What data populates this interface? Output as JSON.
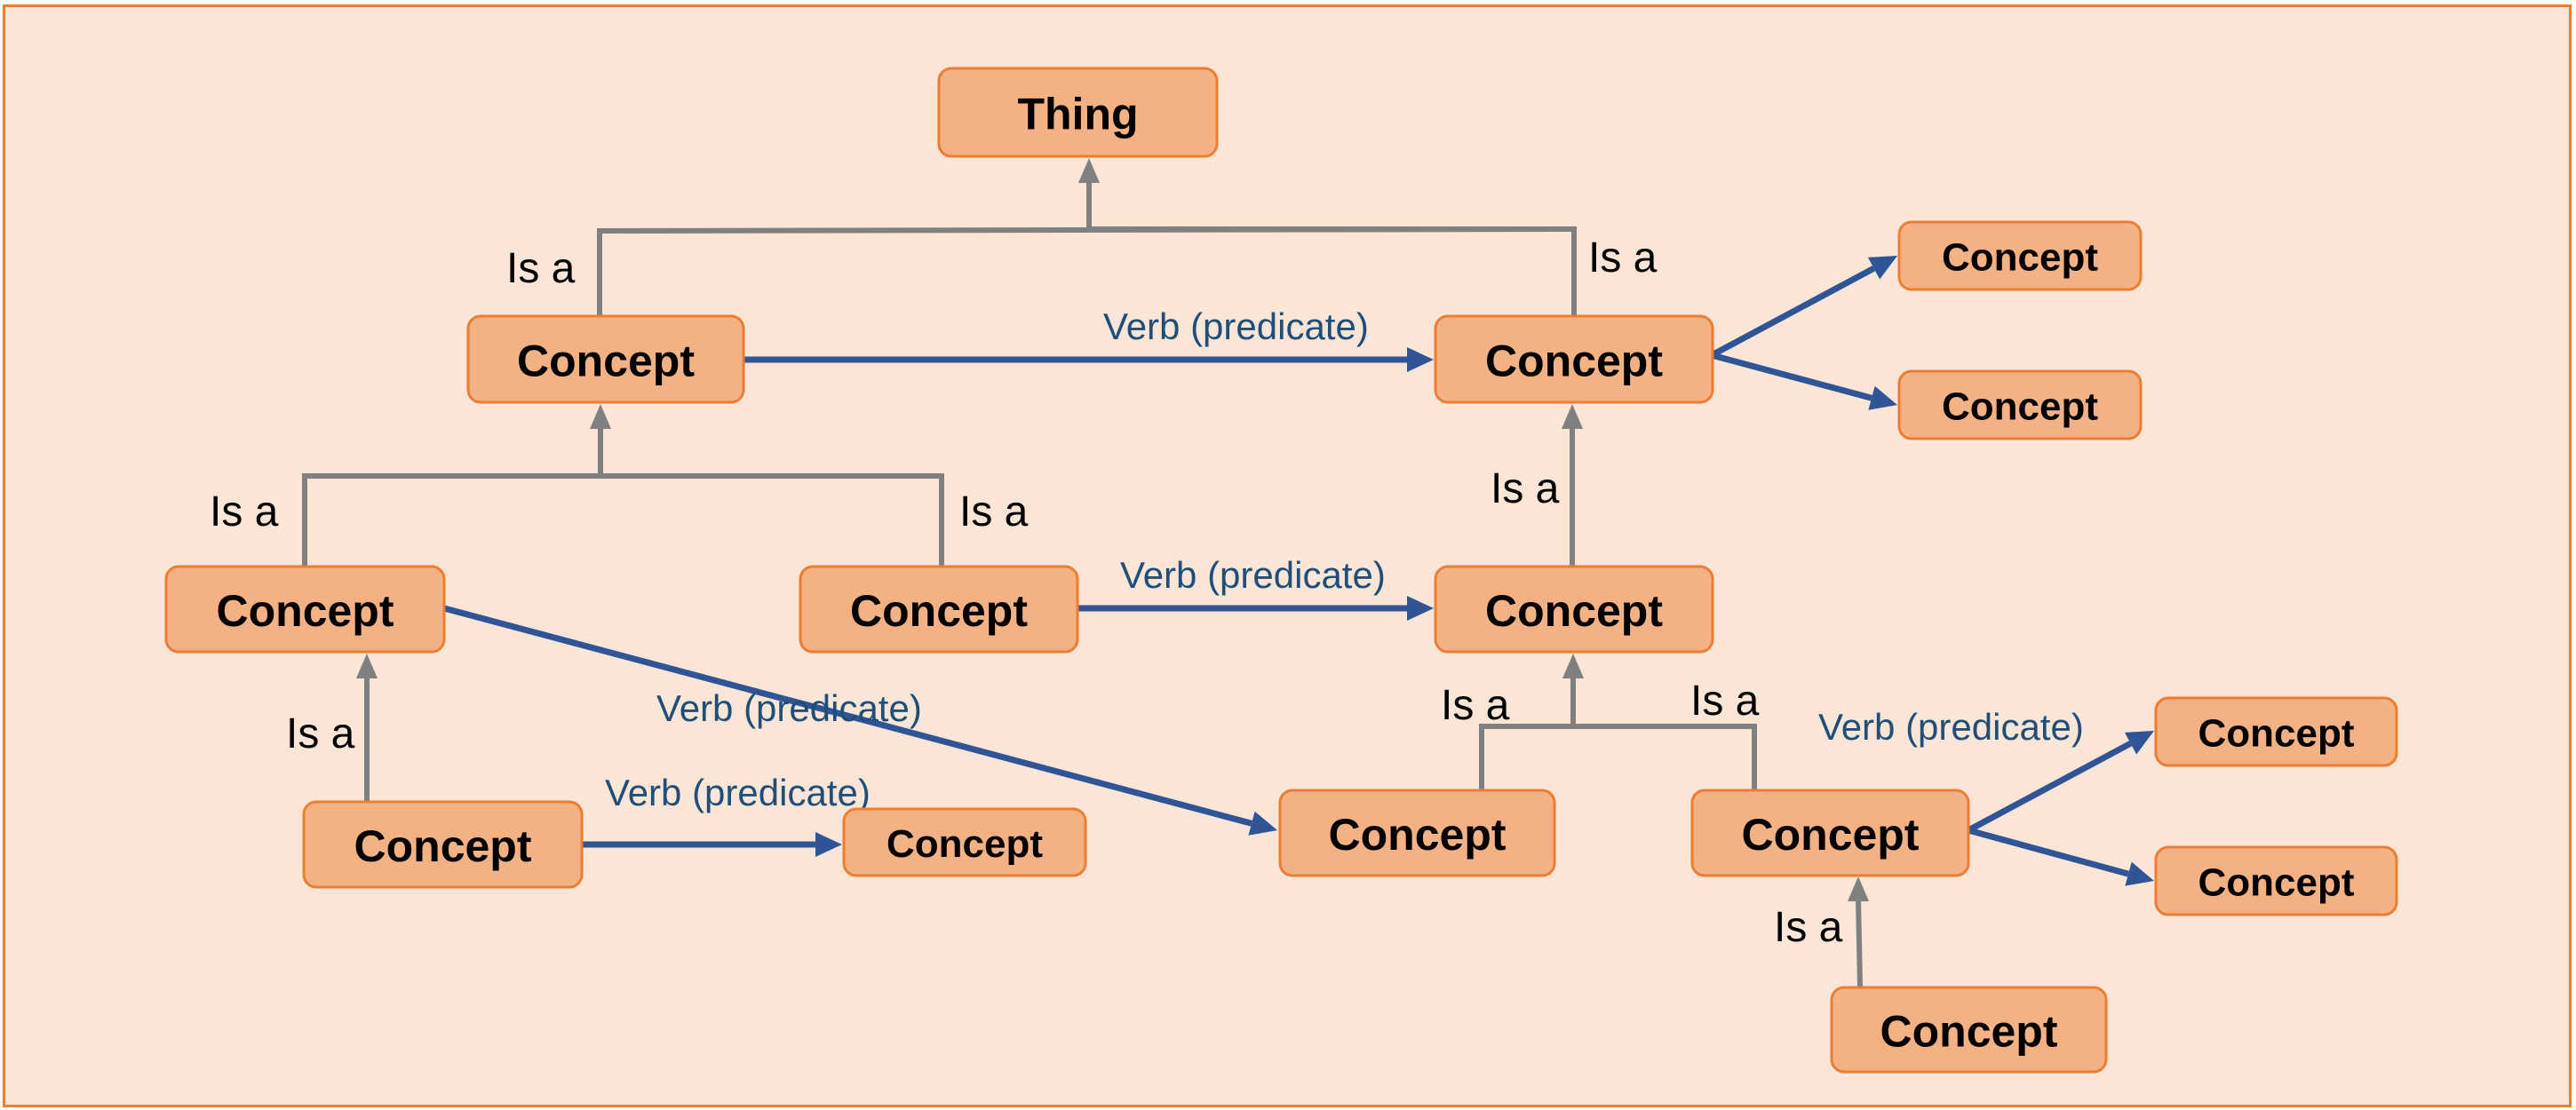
{
  "diagram": {
    "title": "",
    "colors": {
      "background": "#FBE5D6",
      "frame_border": "#ED7D31",
      "node_fill": "#F4B183",
      "node_border": "#ED7D31",
      "isa_edge": "#808080",
      "verb_edge": "#2F5597",
      "verb_label": "#1F4E79",
      "isa_label": "#000000"
    },
    "nodes": [
      {
        "id": "thing",
        "label": "Thing"
      },
      {
        "id": "c1",
        "label": "Concept"
      },
      {
        "id": "c2",
        "label": "Concept"
      },
      {
        "id": "c3",
        "label": "Concept"
      },
      {
        "id": "c4",
        "label": "Concept"
      },
      {
        "id": "c5",
        "label": "Concept"
      },
      {
        "id": "c6",
        "label": "Concept"
      },
      {
        "id": "c7",
        "label": "Concept"
      },
      {
        "id": "c8",
        "label": "Concept"
      },
      {
        "id": "c9",
        "label": "Concept"
      },
      {
        "id": "c10",
        "label": "Concept"
      },
      {
        "id": "c11",
        "label": "Concept"
      },
      {
        "id": "c12",
        "label": "Concept"
      },
      {
        "id": "c13",
        "label": "Concept"
      },
      {
        "id": "c14",
        "label": "Concept"
      }
    ],
    "isa_edges": [
      {
        "from": "c1",
        "to": "thing",
        "label": "Is a"
      },
      {
        "from": "c2",
        "to": "thing",
        "label": "Is a"
      },
      {
        "from": "c5",
        "to": "c1",
        "label": "Is a"
      },
      {
        "from": "c6",
        "to": "c1",
        "label": "Is a"
      },
      {
        "from": "c7",
        "to": "c2",
        "label": "Is a"
      },
      {
        "from": "c8",
        "to": "c5",
        "label": "Is a"
      },
      {
        "from": "c10",
        "to": "c7",
        "label": "Is a"
      },
      {
        "from": "c11",
        "to": "c7",
        "label": "Is a"
      },
      {
        "from": "c14",
        "to": "c11",
        "label": "Is a"
      }
    ],
    "verb_edges": [
      {
        "from": "c1",
        "to": "c2",
        "label": "Verb (predicate)"
      },
      {
        "from": "c2",
        "to": "c3",
        "label": ""
      },
      {
        "from": "c2",
        "to": "c4",
        "label": ""
      },
      {
        "from": "c6",
        "to": "c7",
        "label": "Verb (predicate)"
      },
      {
        "from": "c5",
        "to": "c10",
        "label": "Verb (predicate)"
      },
      {
        "from": "c8",
        "to": "c9",
        "label": "Verb (predicate)"
      },
      {
        "from": "c11",
        "to": "c12",
        "label": "Verb (predicate)"
      },
      {
        "from": "c11",
        "to": "c13",
        "label": ""
      }
    ]
  }
}
